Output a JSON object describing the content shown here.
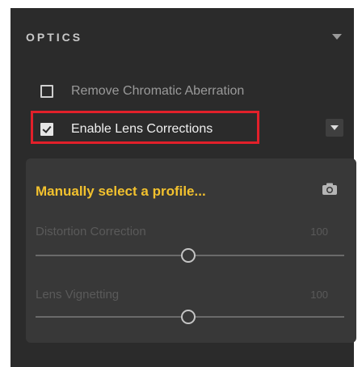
{
  "optics": {
    "title": "OPTICS",
    "remove_chromatic_label": "Remove Chromatic Aberration",
    "remove_chromatic_checked": false,
    "enable_lens_label": "Enable Lens Corrections",
    "enable_lens_checked": true,
    "profile_link": "Manually select a profile...",
    "sliders": [
      {
        "label": "Distortion Correction",
        "value": "100"
      },
      {
        "label": "Lens Vignetting",
        "value": "100"
      }
    ]
  },
  "colors": {
    "panel_bg": "#2b2b2b",
    "subpanel_bg": "#383838",
    "accent_yellow": "#f2c12e",
    "highlight_red": "#e2202a"
  },
  "icons": {
    "collapse": "chevron-down-icon",
    "menu": "chevron-down-icon",
    "camera": "camera-icon"
  }
}
